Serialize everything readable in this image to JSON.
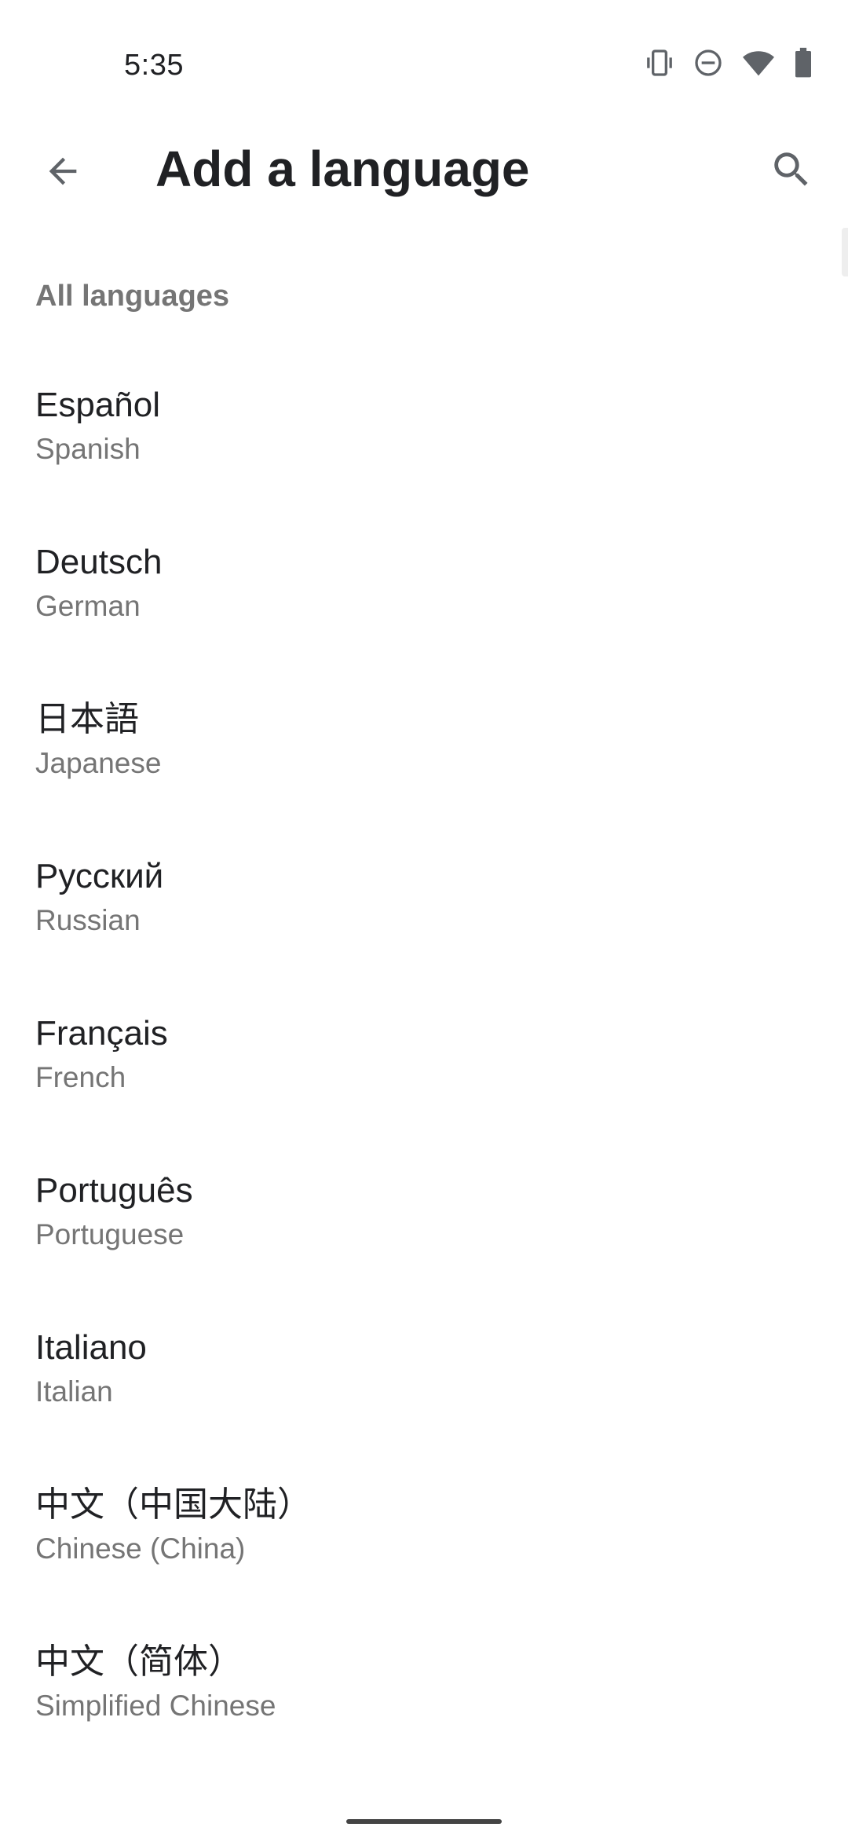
{
  "status_bar": {
    "time": "5:35",
    "icons": [
      "vibrate-icon",
      "do-not-disturb-icon",
      "wifi-icon",
      "battery-icon"
    ]
  },
  "app_bar": {
    "title": "Add a language",
    "back_icon": "arrow-back-icon",
    "search_icon": "search-icon"
  },
  "section": {
    "header": "All languages"
  },
  "languages": [
    {
      "native": "Español",
      "english": "Spanish"
    },
    {
      "native": "Deutsch",
      "english": "German"
    },
    {
      "native": "日本語",
      "english": "Japanese"
    },
    {
      "native": "Русский",
      "english": "Russian"
    },
    {
      "native": "Français",
      "english": "French"
    },
    {
      "native": "Português",
      "english": "Portuguese"
    },
    {
      "native": "Italiano",
      "english": "Italian"
    },
    {
      "native": "中文（中国大陆）",
      "english": "Chinese (China)"
    },
    {
      "native": "中文（简体）",
      "english": "Simplified Chinese"
    }
  ],
  "colors": {
    "primary_text": "#202124",
    "secondary_text": "#757575",
    "background": "#ffffff"
  }
}
